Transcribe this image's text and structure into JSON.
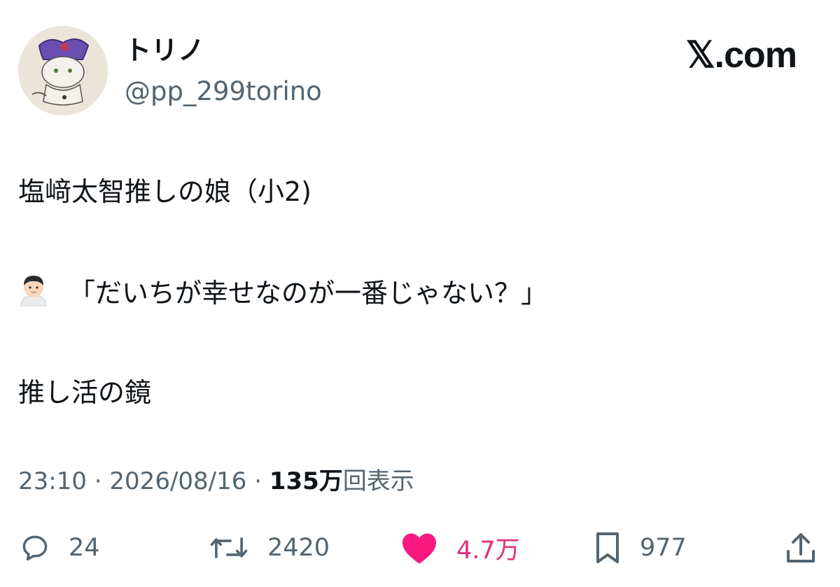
{
  "author": {
    "display_name": "トリノ",
    "handle": "@pp_299torino"
  },
  "brand": {
    "logo_text": "𝕏.com"
  },
  "tweet": {
    "lines": [
      "塩﨑太智推しの娘（小2)",
      "「だいちが幸せなのが一番じゃない？」",
      "推し活の鏡"
    ],
    "line2_emoji": "person-icon"
  },
  "meta": {
    "time": "23:10",
    "separator": " · ",
    "date": "2026/08/16",
    "views_number": "135万",
    "views_label": "回表示"
  },
  "actions": {
    "replies": "24",
    "reposts": "2420",
    "likes": "4.7万",
    "bookmarks": "977"
  },
  "colors": {
    "text": "#0f1419",
    "muted": "#536471",
    "like": "#e0307c"
  },
  "icons": [
    "reply-icon",
    "repost-icon",
    "heart-icon",
    "bookmark-icon",
    "share-icon"
  ]
}
